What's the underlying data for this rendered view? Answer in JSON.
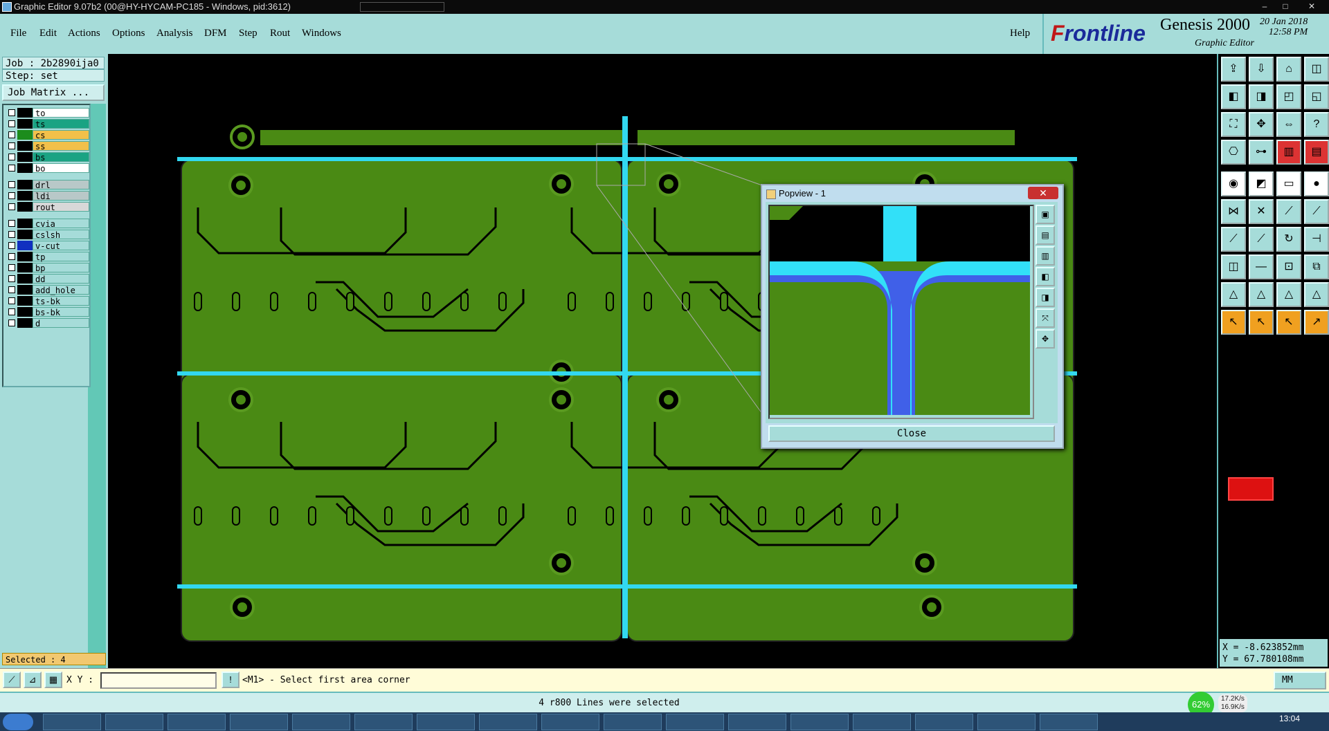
{
  "window": {
    "title": "Graphic Editor 9.07b2 (00@HY-HYCAM-PC185 - Windows, pid:3612)",
    "minimize": "–",
    "maximize": "□",
    "close": "✕"
  },
  "menu": {
    "items": [
      "File",
      "Edit",
      "Actions",
      "Options",
      "Analysis",
      "DFM",
      "Step",
      "Rout",
      "Windows"
    ],
    "help": "Help"
  },
  "brand": {
    "logo_f": "F",
    "logo_rest": "rontline",
    "product": "Genesis 2000",
    "subtitle": "Graphic Editor",
    "date": "20 Jan 2018",
    "time": "12:58 PM"
  },
  "left": {
    "job": "Job : 2b2890ija0",
    "step": "Step: set",
    "job_matrix": "Job Matrix ...",
    "selected": "Selected : 4",
    "layers": [
      {
        "name": "to",
        "color": "#ffffff",
        "swatch": "#000000"
      },
      {
        "name": "ts",
        "color": "#1aa383",
        "swatch": "#000000"
      },
      {
        "name": "cs",
        "color": "#f2c04a",
        "swatch": "#1c8c1c"
      },
      {
        "name": "ss",
        "color": "#f2c04a",
        "swatch": "#000000"
      },
      {
        "name": "bs",
        "color": "#1aa383",
        "swatch": "#000000"
      },
      {
        "name": "bo",
        "color": "#ffffff",
        "swatch": "#000000"
      },
      {
        "name": "drl",
        "color": "#b8c8c8",
        "swatch": "#000000"
      },
      {
        "name": "ldi",
        "color": "#b8c8c8",
        "swatch": "#000000"
      },
      {
        "name": "rout",
        "color": "#d8d8d8",
        "swatch": "#000000"
      },
      {
        "name": "cvia",
        "color": "#a6dcd9",
        "swatch": "#000000"
      },
      {
        "name": "cslsh",
        "color": "#a6dcd9",
        "swatch": "#000000"
      },
      {
        "name": "v-cut",
        "color": "#a6dcd9",
        "swatch": "#1030c0"
      },
      {
        "name": "tp",
        "color": "#a6dcd9",
        "swatch": "#000000"
      },
      {
        "name": "bp",
        "color": "#a6dcd9",
        "swatch": "#000000"
      },
      {
        "name": "dd",
        "color": "#a6dcd9",
        "swatch": "#000000"
      },
      {
        "name": "add_hole",
        "color": "#a6dcd9",
        "swatch": "#000000"
      },
      {
        "name": "ts-bk",
        "color": "#a6dcd9",
        "swatch": "#000000"
      },
      {
        "name": "bs-bk",
        "color": "#a6dcd9",
        "swatch": "#000000"
      },
      {
        "name": "d",
        "color": "#a6dcd9",
        "swatch": "#000000"
      }
    ]
  },
  "command": {
    "xy_label": "X Y :",
    "xy_value": "",
    "prompt": "<M1> - Select first area corner",
    "unit": "MM"
  },
  "coords": {
    "x": "X = -8.623852mm",
    "y": "Y = 67.780108mm"
  },
  "status": {
    "message": "4 r800 Lines were selected"
  },
  "popview": {
    "title": "Popview - 1",
    "close_label": "Close",
    "close_x": "✕"
  },
  "network": {
    "percent": "62%",
    "up": "17.2K/s",
    "down": "16.9K/s"
  },
  "taskbar": {
    "time": "13:04"
  },
  "colors": {
    "board_green": "#4a8a14",
    "vcut_cyan": "#32d8f0",
    "panel_teal": "#a6dcd9"
  }
}
